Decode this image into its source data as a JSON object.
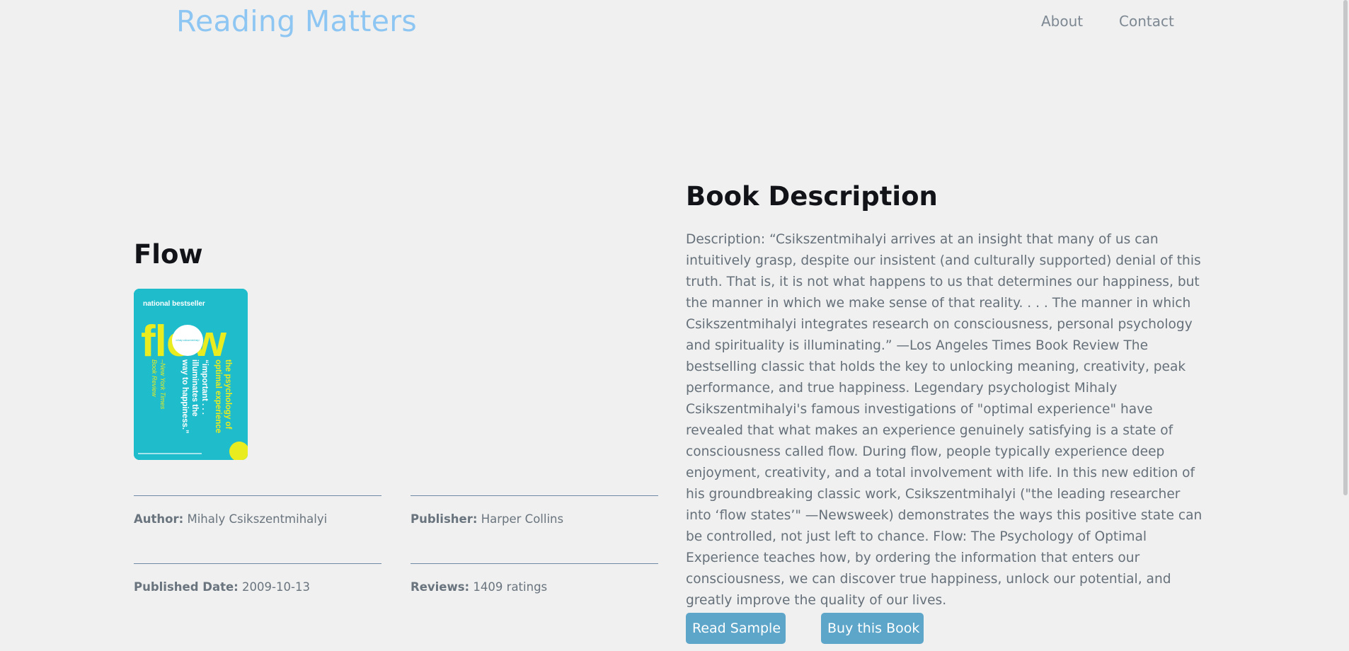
{
  "header": {
    "brand": "Reading Matters",
    "nav": {
      "about": "About",
      "contact": "Contact"
    }
  },
  "book": {
    "title": "Flow",
    "cover": {
      "tagline": "national bestseller",
      "word": "flow",
      "subtitle_line1": "the psychology of",
      "subtitle_line2": "optimal experience",
      "quote_line1": "“important . . .",
      "quote_line2": "illuminates the",
      "quote_line3": "way to happiness.”",
      "source_line1": "–New York Times",
      "source_line2": "Book Review",
      "circle_text": "mihaly csikszentmihalyi",
      "colors": {
        "background": "#1fbccb",
        "accent": "#e9ec1f"
      }
    },
    "meta": {
      "author_label": "Author:",
      "author": "Mihaly Csikszentmihalyi",
      "publisher_label": "Publisher:",
      "publisher": "Harper Collins",
      "date_label": "Published Date:",
      "date": "2009-10-13",
      "reviews_label": "Reviews:",
      "reviews": "1409 ratings"
    }
  },
  "description": {
    "heading": "Book Description",
    "text": "Description: “Csikszentmihalyi arrives at an insight that many of us can intuitively grasp, despite our insistent (and culturally supported) denial of this truth. That is, it is not what happens to us that determines our happiness, but the manner in which we make sense of that reality. . . . The manner in which Csikszentmihalyi integrates research on consciousness, personal psychology and spirituality is illuminating.” —Los Angeles Times Book Review The bestselling classic that holds the key to unlocking meaning, creativity, peak performance, and true happiness. Legendary psychologist Mihaly Csikszentmihalyi's famous investigations of \"optimal experience\" have revealed that what makes an experience genuinely satisfying is a state of consciousness called flow. During flow, people typically experience deep enjoyment, creativity, and a total involvement with life. In this new edition of his groundbreaking classic work, Csikszentmihalyi (\"the leading researcher into ‘flow states’\" —Newsweek) demonstrates the ways this positive state can be controlled, not just left to chance. Flow: The Psychology of Optimal Experience teaches how, by ordering the information that enters our consciousness, we can discover true happiness, unlock our potential, and greatly improve the quality of our lives."
  },
  "actions": {
    "read_sample": "Read Sample",
    "buy": "Buy this Book"
  },
  "colors": {
    "page_background": "#eff0ef",
    "brand": "#8ec6f3",
    "button": "#5da6c9",
    "rule": "#6e8aa6"
  }
}
